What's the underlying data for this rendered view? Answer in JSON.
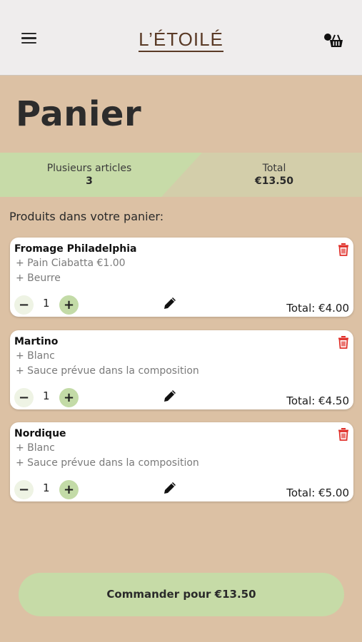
{
  "header": {
    "logo": "L’ÉTOILÉ",
    "menu_icon": "hamburger-menu-icon",
    "cart_icon": "basket-icon"
  },
  "page": {
    "title": "Panier"
  },
  "summary": {
    "items_label": "Plusieurs articles",
    "items_count": "3",
    "total_label": "Total",
    "total_value": "€13.50"
  },
  "section_label": "Produits dans votre panier:",
  "cart": [
    {
      "name": "Fromage Philadelphia",
      "options": [
        "+ Pain Ciabatta €1.00",
        "+ Beurre"
      ],
      "qty": "1",
      "minus": "−",
      "plus": "+",
      "total": "Total: €4.00"
    },
    {
      "name": "Martino",
      "options": [
        "+ Blanc",
        "+ Sauce prévue dans la composition"
      ],
      "qty": "1",
      "minus": "−",
      "plus": "+",
      "total": "Total: €4.50"
    },
    {
      "name": "Nordique",
      "options": [
        "+ Blanc",
        "+ Sauce prévue dans la composition"
      ],
      "qty": "1",
      "minus": "−",
      "plus": "+",
      "total": "Total: €5.00"
    }
  ],
  "order_button": "Commander pour €13.50",
  "colors": {
    "background": "#dcc1a4",
    "header": "#efeded",
    "accent_green": "#c6dba7",
    "delete_red": "#e0312b",
    "logo_brown": "#5a3a26"
  }
}
